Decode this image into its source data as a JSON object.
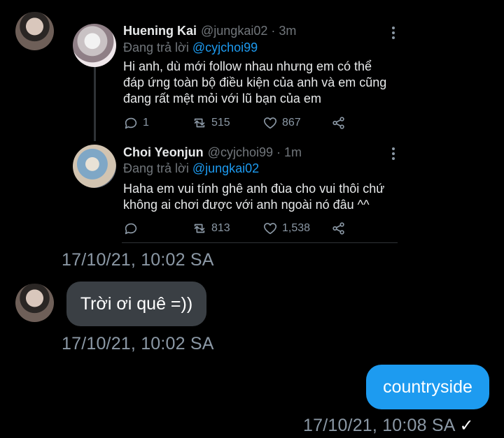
{
  "tweet1": {
    "name": "Huening Kai",
    "handle": "@jungkai02 · 3m",
    "reply_prefix": "Đang trả lời ",
    "reply_mention": "@cyjchoi99",
    "text": "Hi anh, dù mới follow nhau nhưng em có thể đáp ứng toàn bộ điều kiện của anh và em cũng đang rất mệt mỏi với lũ bạn của em",
    "replies": "1",
    "retweets": "515",
    "likes": "867"
  },
  "tweet2": {
    "name": "Choi Yeonjun",
    "handle": "@cyjchoi99 · 1m",
    "reply_prefix": "Đang trả lời ",
    "reply_mention": "@jungkai02",
    "text": "Haha em vui tính ghê anh đùa cho vui thôi chứ không ai chơi được với anh ngoài nó đâu ^^",
    "replies": "",
    "retweets": "813",
    "likes": "1,538"
  },
  "messages": [
    {
      "timestamp": "17/10/21, 10:02 SA"
    },
    {
      "text": "Trời ơi quê =))",
      "timestamp": "17/10/21, 10:02 SA"
    },
    {
      "text": "countryside",
      "timestamp": "17/10/21, 10:08 SA",
      "status": "✓"
    }
  ],
  "icons": [
    "reply-icon",
    "retweet-icon",
    "like-icon",
    "share-icon",
    "more-icon"
  ],
  "colors": {
    "mention": "#1d9bf0",
    "outgoing_bubble": "#1d9bf0",
    "incoming_bubble": "#3a3f44"
  }
}
